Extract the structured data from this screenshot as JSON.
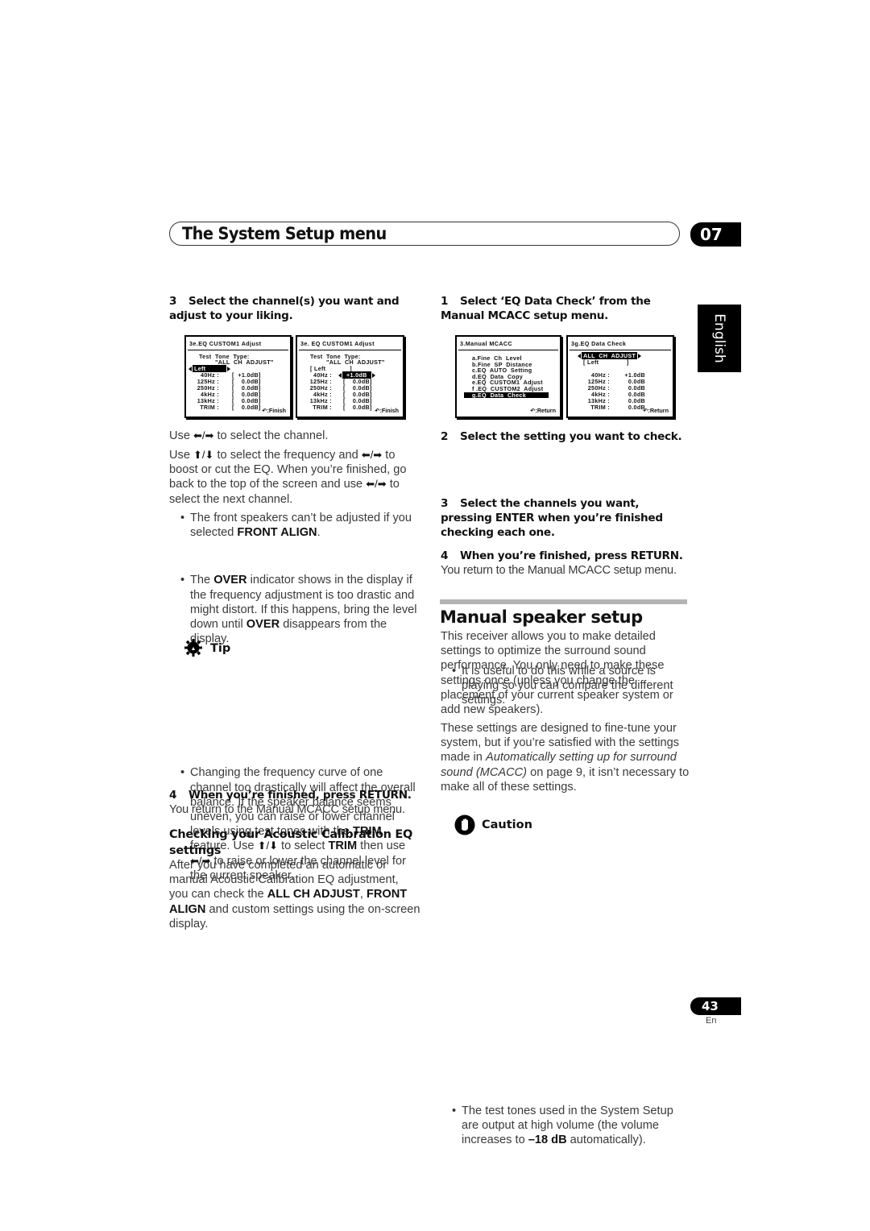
{
  "header": {
    "title": "The System Setup menu",
    "chapter": "07",
    "language_tab": "English"
  },
  "left_column": {
    "step3_num": "3",
    "step3_text": "Select the channel(s) you want and adjust to your liking.",
    "screen1": {
      "title": "3e.EQ  CUSTOM1  Adjust",
      "test_tone_label": "Test  Tone  Type:",
      "test_tone_value": "\"ALL  CH  ADJUST\"",
      "channel": "Left",
      "rows": [
        {
          "freq": "40Hz :",
          "value": "+1.0dB"
        },
        {
          "freq": "125Hz :",
          "value": "0.0dB"
        },
        {
          "freq": "250Hz :",
          "value": "0.0dB"
        },
        {
          "freq": "4kHz :",
          "value": "0.0dB"
        },
        {
          "freq": "13kHz :",
          "value": "0.0dB"
        },
        {
          "freq": "TRIM :",
          "value": "0.0dB"
        }
      ],
      "footer": ":Finish"
    },
    "screen2": {
      "title": "3e. EQ  CUSTOM1  Adjust",
      "test_tone_label": "Test  Tone  Type:",
      "test_tone_value": "\"ALL  CH  ADJUST\"",
      "channel": "Left",
      "rows": [
        {
          "freq": "40Hz :",
          "value": "+1.0dB"
        },
        {
          "freq": "125Hz :",
          "value": "0.0dB"
        },
        {
          "freq": "250Hz :",
          "value": "0.0dB"
        },
        {
          "freq": "4kHz :",
          "value": "0.0dB"
        },
        {
          "freq": "13kHz :",
          "value": "0.0dB"
        },
        {
          "freq": "TRIM :",
          "value": "0.0dB"
        }
      ],
      "footer": ":Finish"
    },
    "use_lr_a": "Use",
    "use_lr_b": "to select the channel.",
    "para2_a": "Use",
    "para2_b": "to select the frequency and",
    "para2_c": "to boost or cut the EQ. When you’re finished, go back to the top of the screen and use",
    "para2_d": "to select the next channel.",
    "bullet1_a": "The front speakers can’t be adjusted if you selected ",
    "bullet1_b": "FRONT ALIGN",
    "bullet1_c": ".",
    "bullet2_a": "The ",
    "bullet2_b": "OVER",
    "bullet2_c": " indicator shows in the display if the frequency adjustment is too drastic and might distort. If this happens, bring the level down until ",
    "bullet2_d": "OVER",
    "bullet2_e": " disappears from the display.",
    "tip_label": "Tip",
    "tip_a": "Changing the frequency curve of one channel too drastically will affect the overall balance. If the speaker balance seems uneven, you can raise or lower channel levels using test tones with the ",
    "tip_b": "TRIM",
    "tip_c": " feature. Use ",
    "tip_d": " to select ",
    "tip_e": "TRIM",
    "tip_f": " then use ",
    "tip_g": " to raise or lower the channel level for the current speaker.",
    "step4_num": "4",
    "step4_text": "When you’re finished, press RETURN.",
    "step4_body": "You return to the Manual MCACC setup menu.",
    "checking_heading": "Checking your Acoustic Calibration EQ settings",
    "checking_a": "After you have completed an automatic or manual Acoustic Calibration EQ adjustment, you can check the ",
    "checking_b": "ALL CH ADJUST",
    "checking_c": ", ",
    "checking_d": "FRONT ALIGN",
    "checking_e": " and custom settings using the on-screen display."
  },
  "right_column": {
    "step1_num": "1",
    "step1_text": "Select ‘EQ Data Check’ from the Manual MCACC setup menu.",
    "screen3": {
      "title": "3.Manual  MCACC",
      "items": [
        "a.Fine  Ch  Level",
        "b.Fine  SP  Distance",
        "c.EQ  AUTO  Setting",
        "d.EQ  Data  Copy",
        "e.EQ  CUSTOM1  Adjust",
        "f .EQ  CUSTOM2  Adjust",
        "g.EQ  Data  Check"
      ],
      "selected_index": 6,
      "footer": ":Return"
    },
    "screen4": {
      "title": "3g.EQ  Data  Check",
      "mode": "ALL  CH  ADJUST",
      "channel": "Left",
      "rows": [
        {
          "freq": "40Hz :",
          "value": "+1.0dB"
        },
        {
          "freq": "125Hz :",
          "value": "0.0dB"
        },
        {
          "freq": "250Hz :",
          "value": "0.0dB"
        },
        {
          "freq": "4kHz :",
          "value": "0.0dB"
        },
        {
          "freq": "13kHz :",
          "value": "0.0dB"
        },
        {
          "freq": "TRIM :",
          "value": "0.0dB"
        }
      ],
      "footer": ":Return"
    },
    "step2_num": "2",
    "step2_text": "Select the setting you want to check.",
    "step2_bullet": "It is useful to do this while a source is playing so you can compare the different settings.",
    "step3_num": "3",
    "step3_text": "Select the channels you want, pressing ENTER when you’re finished checking each one.",
    "step4_num": "4",
    "step4_text": "When you’re finished, press RETURN.",
    "step4_body": "You return to the Manual MCACC setup menu.",
    "manual_heading": "Manual speaker setup",
    "manual_p1": "This receiver allows you to make detailed settings to optimize the surround sound performance. You only need to make these settings once (unless you change the placement of your current speaker system or add new speakers).",
    "manual_p2_a": "These settings are designed to fine-tune your system, but if you’re satisfied with the settings made in ",
    "manual_p2_b": "Automatically setting up for surround sound (MCACC)",
    "manual_p2_c": " on page 9, it isn’t necessary to make all of these settings.",
    "caution_label": "Caution",
    "caution_a": "The test tones used in the System Setup are output at high volume (the volume increases to ",
    "caution_b": "–18 dB",
    "caution_c": " automatically)."
  },
  "footer": {
    "page_number": "43",
    "language": "En"
  },
  "icons": {
    "left_right": "⬅/➡",
    "up_down": "⬆/⬇"
  }
}
